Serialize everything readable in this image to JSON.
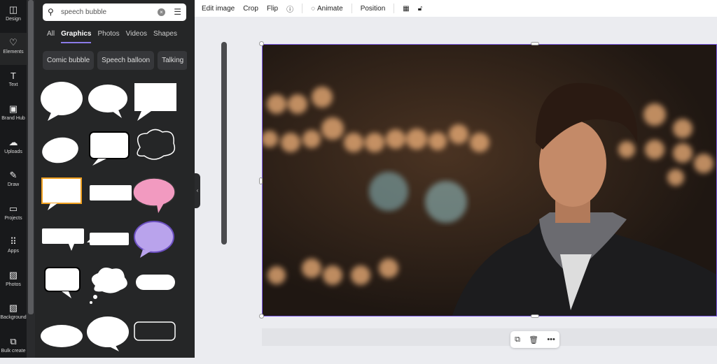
{
  "rail": [
    {
      "label": "Design",
      "icon": "layout-icon"
    },
    {
      "label": "Elements",
      "icon": "shapes-icon",
      "active": true
    },
    {
      "label": "Text",
      "icon": "text-icon"
    },
    {
      "label": "Brand Hub",
      "icon": "brand-icon"
    },
    {
      "label": "Uploads",
      "icon": "upload-cloud-icon"
    },
    {
      "label": "Draw",
      "icon": "pen-icon"
    },
    {
      "label": "Projects",
      "icon": "folder-icon"
    },
    {
      "label": "Apps",
      "icon": "apps-grid-icon"
    },
    {
      "label": "Photos",
      "icon": "image-icon"
    },
    {
      "label": "Background",
      "icon": "hatch-icon"
    },
    {
      "label": "Bulk create",
      "icon": "bulk-icon"
    }
  ],
  "search": {
    "value": "speech bubble"
  },
  "tabs": [
    "All",
    "Graphics",
    "Photos",
    "Videos",
    "Shapes"
  ],
  "active_tab": "Graphics",
  "chips": [
    "Comic bubble",
    "Speech balloon",
    "Talking"
  ],
  "toolbar": {
    "edit_image": "Edit image",
    "crop": "Crop",
    "flip": "Flip",
    "animate": "Animate",
    "position": "Position"
  },
  "colors": {
    "accent": "#7d5ce6",
    "panel": "#252627",
    "rail": "#18191b"
  }
}
